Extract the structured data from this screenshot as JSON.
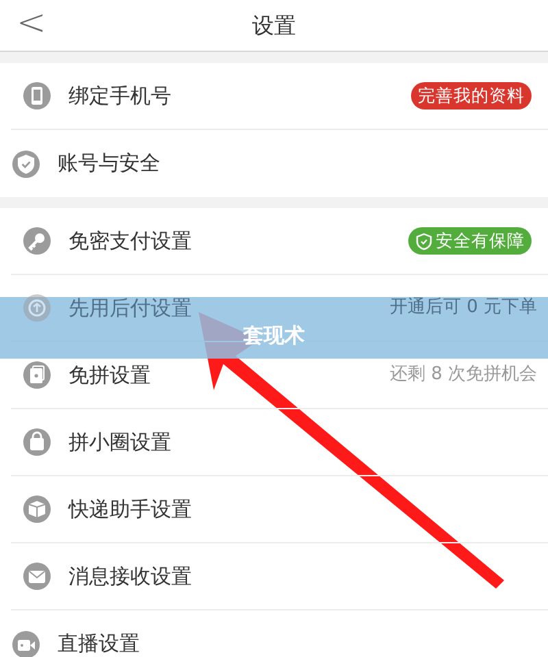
{
  "header": {
    "back": "<",
    "title": "设置"
  },
  "groups": [
    {
      "items": [
        {
          "label": "绑定手机号",
          "badge": {
            "text": "完善我的资料",
            "color": "#d9372e",
            "shield": false
          }
        },
        {
          "label": "账号与安全"
        }
      ]
    },
    {
      "items": [
        {
          "label": "免密支付设置",
          "badge": {
            "text": "安全有保障",
            "color": "#52ad3c",
            "shield": true
          }
        },
        {
          "label": "先用后付设置",
          "hint": "开通后可 0 元下单",
          "highlighted": true
        },
        {
          "label": "免拼设置",
          "hint": "还剩 8 次免拼机会"
        },
        {
          "label": "拼小圈设置"
        },
        {
          "label": "快递助手设置"
        },
        {
          "label": "消息接收设置"
        },
        {
          "label": "直播设置"
        }
      ]
    }
  ],
  "annotation": {
    "label": "套现术"
  }
}
